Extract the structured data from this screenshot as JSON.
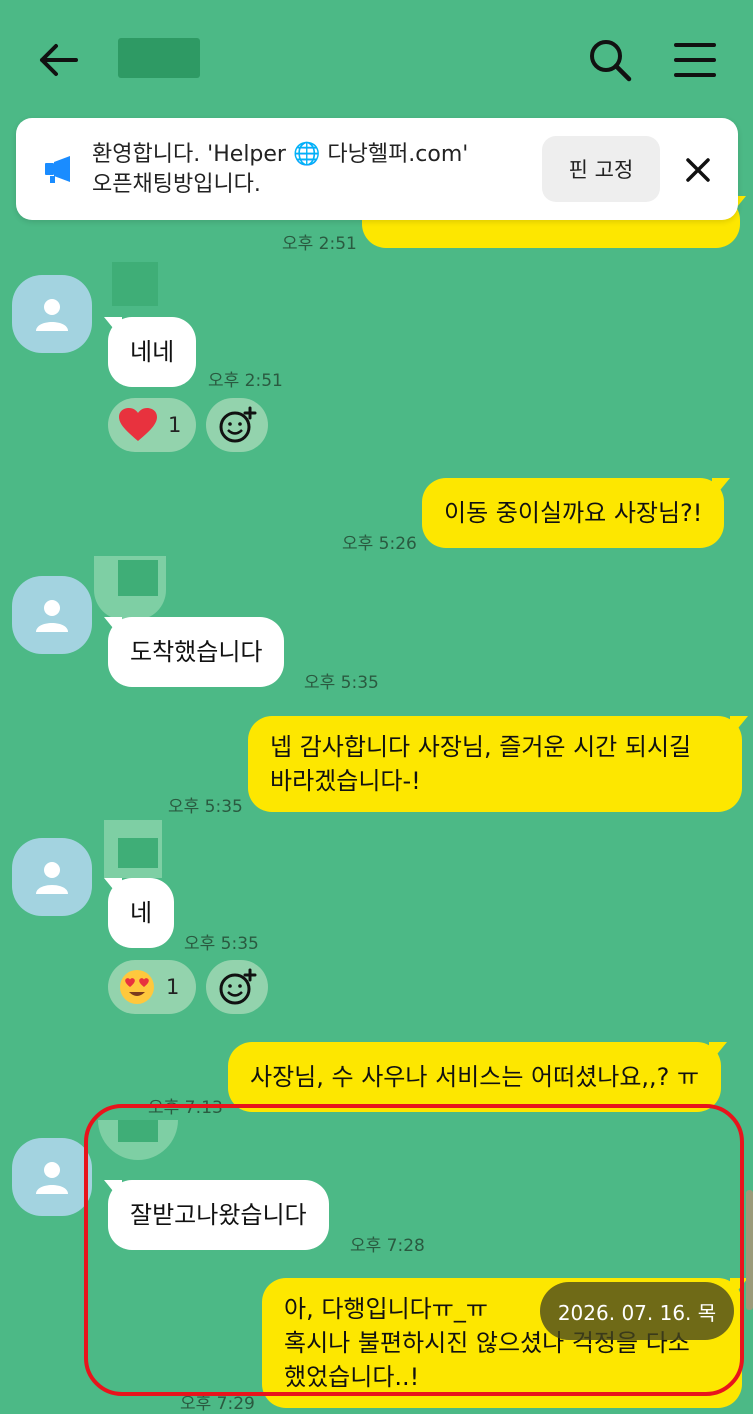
{
  "header": {
    "back_icon": "arrow-left-icon",
    "search_icon": "search-icon",
    "menu_icon": "hamburger-menu-icon"
  },
  "notice": {
    "icon": "megaphone-icon",
    "line1": "환영합니다. 'Helper 🌐 다낭헬퍼.com'",
    "line2": "오픈채팅방입니다.",
    "pin_label": "핀 고정",
    "close_icon": "close-icon"
  },
  "messages": {
    "m0": {
      "time": "오후 2:51"
    },
    "m1": {
      "text": "네네",
      "time": "오후 2:51",
      "reaction_count": "1",
      "reaction_icon": "heart-icon"
    },
    "m2": {
      "text": "이동 중이실까요 사장님?!",
      "time": "오후 5:26"
    },
    "m3": {
      "text": "도착했습니다",
      "time": "오후 5:35"
    },
    "m4": {
      "line1": "넵 감사합니다 사장님, 즐거운 시간 되시길",
      "line2": "바라겠습니다-!",
      "time": "오후 5:35"
    },
    "m5": {
      "text": "네",
      "time": "오후 5:35",
      "reaction_count": "1",
      "reaction_icon": "heart-eyes-emoji-icon"
    },
    "m6": {
      "text": "사장님, 수 사우나 서비스는 어떠셨나요,,? ㅠ",
      "time": "오후 7:13"
    },
    "m7": {
      "text": "잘받고나왔습니다",
      "time": "오후 7:28"
    },
    "m8": {
      "line1": "아, 다행입니다ㅠ_ㅠ",
      "line2": "혹시나 불편하시진 않으셨나 걱정을 다소",
      "line3": "했었습니다..!",
      "time": "오후 7:29"
    }
  },
  "date_pill": "2026. 07. 16. 목",
  "colors": {
    "background": "#4cb986",
    "outgoing_bubble": "#fde700",
    "incoming_bubble": "#ffffff",
    "highlight_box": "#e8141c"
  }
}
